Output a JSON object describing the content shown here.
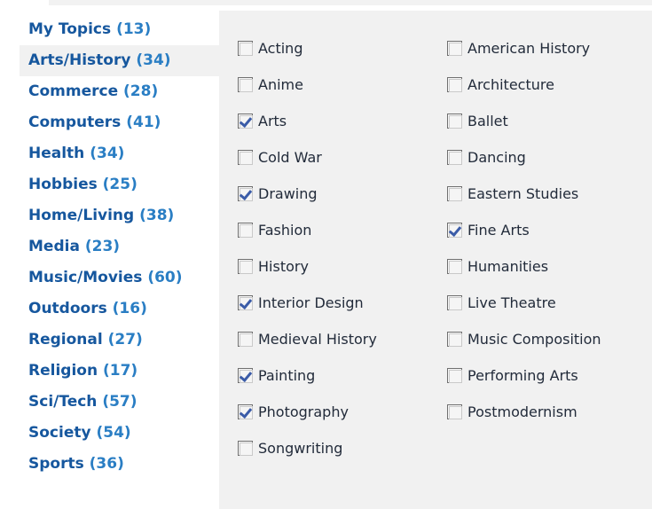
{
  "sidebar": {
    "items": [
      {
        "name": "My Topics",
        "count": "(13)",
        "active": false
      },
      {
        "name": "Arts/History",
        "count": "(34)",
        "active": true
      },
      {
        "name": "Commerce",
        "count": "(28)",
        "active": false
      },
      {
        "name": "Computers",
        "count": "(41)",
        "active": false
      },
      {
        "name": "Health",
        "count": "(34)",
        "active": false
      },
      {
        "name": "Hobbies",
        "count": "(25)",
        "active": false
      },
      {
        "name": "Home/Living",
        "count": "(38)",
        "active": false
      },
      {
        "name": "Media",
        "count": "(23)",
        "active": false
      },
      {
        "name": "Music/Movies",
        "count": "(60)",
        "active": false
      },
      {
        "name": "Outdoors",
        "count": "(16)",
        "active": false
      },
      {
        "name": "Regional",
        "count": "(27)",
        "active": false
      },
      {
        "name": "Religion",
        "count": "(17)",
        "active": false
      },
      {
        "name": "Sci/Tech",
        "count": "(57)",
        "active": false
      },
      {
        "name": "Society",
        "count": "(54)",
        "active": false
      },
      {
        "name": "Sports",
        "count": "(36)",
        "active": false
      }
    ]
  },
  "panel": {
    "columns": [
      {
        "items": [
          {
            "label": "Acting",
            "checked": false
          },
          {
            "label": "Anime",
            "checked": false
          },
          {
            "label": "Arts",
            "checked": true
          },
          {
            "label": "Cold War",
            "checked": false
          },
          {
            "label": "Drawing",
            "checked": true
          },
          {
            "label": "Fashion",
            "checked": false
          },
          {
            "label": "History",
            "checked": false
          },
          {
            "label": "Interior Design",
            "checked": true
          },
          {
            "label": "Medieval History",
            "checked": false
          },
          {
            "label": "Painting",
            "checked": true
          },
          {
            "label": "Photography",
            "checked": true
          },
          {
            "label": "Songwriting",
            "checked": false
          }
        ]
      },
      {
        "items": [
          {
            "label": "American History",
            "checked": false
          },
          {
            "label": "Architecture",
            "checked": false
          },
          {
            "label": "Ballet",
            "checked": false
          },
          {
            "label": "Dancing",
            "checked": false
          },
          {
            "label": "Eastern Studies",
            "checked": false
          },
          {
            "label": "Fine Arts",
            "checked": true
          },
          {
            "label": "Humanities",
            "checked": false
          },
          {
            "label": "Live Theatre",
            "checked": false
          },
          {
            "label": "Music Composition",
            "checked": false
          },
          {
            "label": "Performing Arts",
            "checked": false
          },
          {
            "label": "Postmodernism",
            "checked": false
          }
        ]
      }
    ]
  },
  "colors": {
    "link_blue": "#16579e",
    "count_blue": "#2a7ec4",
    "panel_bg": "#f1f1f1",
    "active_row_bg": "#f1f1f1",
    "check_mark": "#3b5ca8",
    "label_text": "#222b3a"
  }
}
